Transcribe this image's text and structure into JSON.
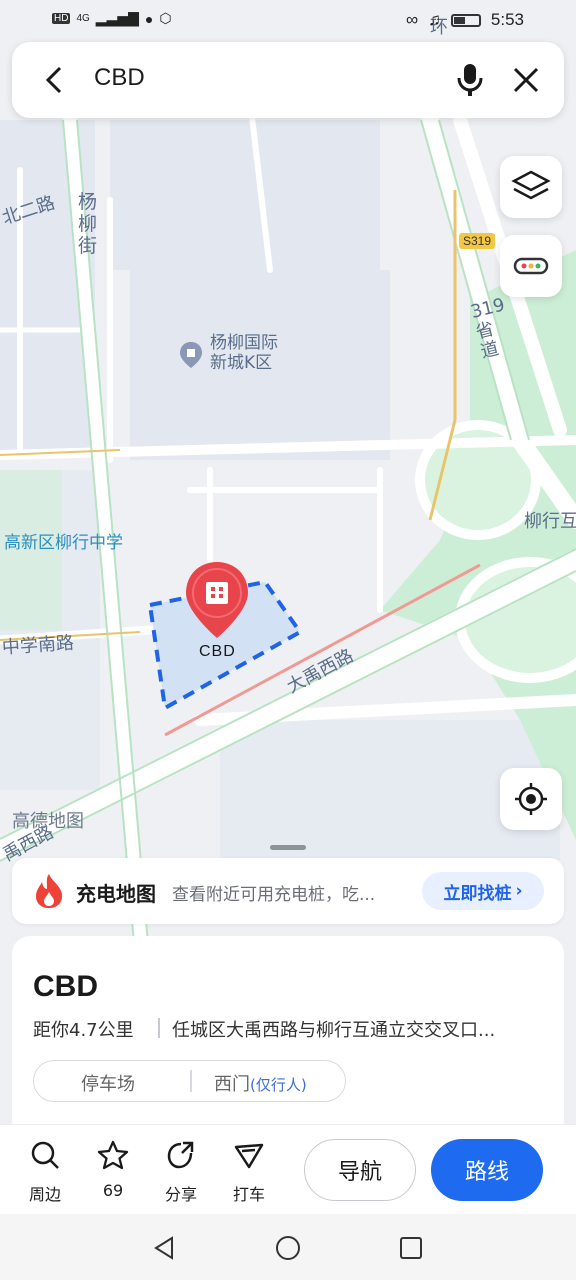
{
  "status": {
    "left": [
      "HD",
      "4G"
    ],
    "time": "5:53"
  },
  "search": {
    "query": "CBD"
  },
  "map": {
    "labels": {
      "yangliu_street": "杨柳街",
      "north2_road": "北二路",
      "community": "杨柳国际新城K区",
      "school": "高新区柳行中学",
      "middle_school_south_road": "中学南路",
      "dayu_west_road": "大禹西路",
      "dayu_west_road_lower": "禹西路",
      "province_road": "319省道",
      "highway_badge": "S319",
      "liuxing_interchange": "柳行互",
      "ring": "环",
      "watermark": "高德地图"
    },
    "marker_label": "CBD"
  },
  "charge_banner": {
    "title": "充电地图",
    "desc": "查看附近可用充电桩，吃...",
    "cta": "立即找桩"
  },
  "poi": {
    "name": "CBD",
    "distance": "距你4.7公里",
    "address": "任城区大禹西路与柳行互通立交交叉口...",
    "tag1": "停车场",
    "tag2": "西门",
    "tag2_sub": "(仅行人)"
  },
  "actions": [
    {
      "label": "周边",
      "icon": "search-icon"
    },
    {
      "label": "69",
      "icon": "star-icon"
    },
    {
      "label": "分享",
      "icon": "share-icon"
    },
    {
      "label": "打车",
      "icon": "taxi-icon"
    }
  ],
  "buttons": {
    "navigate": "导航",
    "route": "路线"
  },
  "colors": {
    "accent": "#1f6bf0",
    "marker": "#e8444b",
    "park": "#cdeed6",
    "selection": "#1f63e6"
  }
}
